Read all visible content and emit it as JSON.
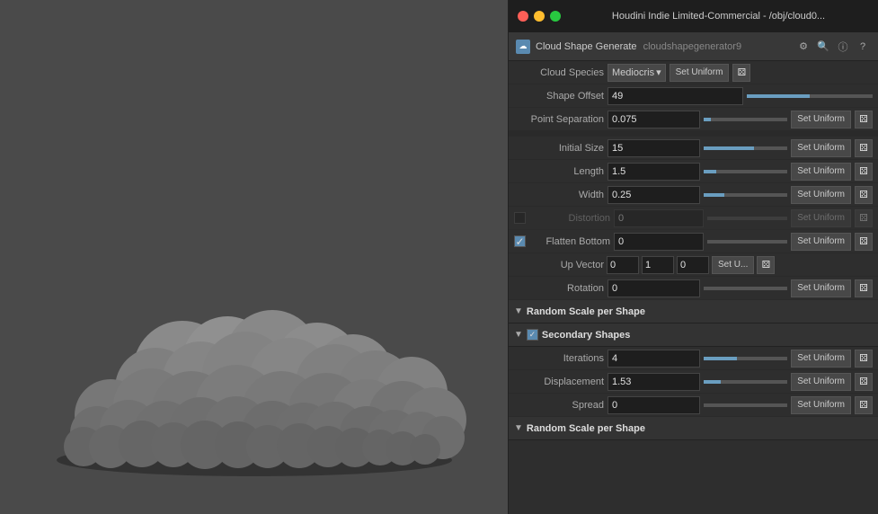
{
  "window": {
    "title": "Houdini Indie Limited-Commercial - /obj/cloud0..."
  },
  "traffic_lights": {
    "red": "close",
    "yellow": "minimize",
    "green": "maximize"
  },
  "node": {
    "icon_label": "☁",
    "name": "Cloud Shape Generate",
    "id": "cloudshapegenerator9"
  },
  "header_buttons": {
    "settings": "⚙",
    "search": "🔍",
    "info": "ⓘ",
    "help": "?"
  },
  "properties": {
    "cloud_species": {
      "label": "Cloud Species",
      "value": "Mediocris",
      "set_uniform": "Set Uniform"
    },
    "shape_offset": {
      "label": "Shape Offset",
      "value": "49"
    },
    "point_separation": {
      "label": "Point Separation",
      "value": "0.075",
      "set_uniform": "Set Uniform"
    },
    "initial_size": {
      "label": "Initial Size",
      "value": "15",
      "set_uniform": "Set Uniform"
    },
    "length": {
      "label": "Length",
      "value": "1.5",
      "set_uniform": "Set Uniform"
    },
    "width": {
      "label": "Width",
      "value": "0.25",
      "set_uniform": "Set Uniform"
    },
    "distortion": {
      "label": "Distortion",
      "value": "0",
      "set_uniform": "Set Uniform",
      "disabled": true
    },
    "flatten_bottom": {
      "label": "Flatten Bottom",
      "value": "0",
      "set_uniform": "Set Uniform",
      "checked": true
    },
    "up_vector": {
      "label": "Up Vector",
      "x": "0",
      "y": "1",
      "z": "0",
      "set_uniform": "Set U..."
    },
    "rotation": {
      "label": "Rotation",
      "value": "0",
      "set_uniform": "Set Uniform"
    }
  },
  "sections": {
    "random_scale": {
      "label": "Random Scale per Shape",
      "collapsed": false
    },
    "secondary_shapes": {
      "label": "Secondary Shapes",
      "checked": true
    },
    "random_scale2": {
      "label": "Random Scale per Shape",
      "collapsed": false
    }
  },
  "secondary": {
    "iterations": {
      "label": "Iterations",
      "value": "4",
      "set_uniform": "Set Uniform"
    },
    "displacement": {
      "label": "Displacement",
      "value": "1.53",
      "set_uniform": "Set Uniform"
    },
    "spread": {
      "label": "Spread",
      "value": "0",
      "set_uniform": "Set Uniform"
    }
  },
  "colors": {
    "accent": "#5a8ab0",
    "slider": "#6a9ec0",
    "bg_panel": "#2e2e2e",
    "bg_input": "#1e1e1e"
  }
}
